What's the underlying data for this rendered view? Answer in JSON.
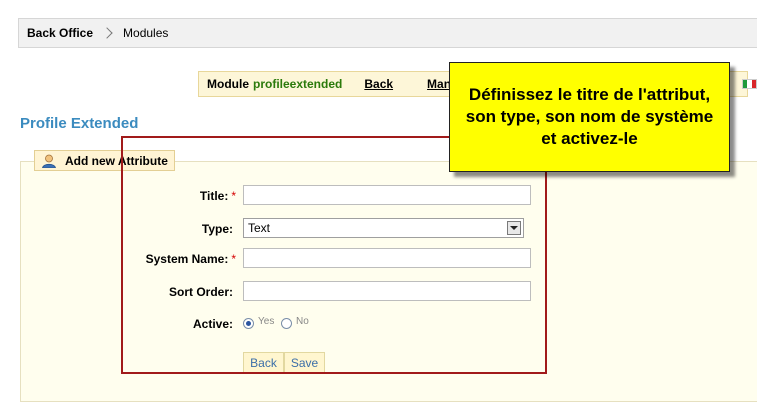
{
  "breadcrumb": {
    "first": "Back Office",
    "second": "Modules"
  },
  "module_bar": {
    "prefix": "Module",
    "module_name": "profileextended",
    "back_link": "Back",
    "manage_link": "Mana"
  },
  "page_title": "Profile Extended",
  "form": {
    "legend": "Add new Attribute",
    "required_mark": "*",
    "title_label": "Title:",
    "type_label": "Type:",
    "type_value": "Text",
    "system_name_label": "System Name:",
    "sort_order_label": "Sort Order:",
    "active_label": "Active:",
    "active_yes": "Yes",
    "active_no": "No",
    "back_button": "Back",
    "save_button": "Save"
  },
  "callout": {
    "text": "Définissez le titre de l'attribut, son type, son nom de système et activez-le"
  },
  "colors": {
    "callout_bg": "#ffff00",
    "frame": "#a11a1a",
    "title": "#3b8bbf",
    "module_name": "#2b7a0b"
  }
}
